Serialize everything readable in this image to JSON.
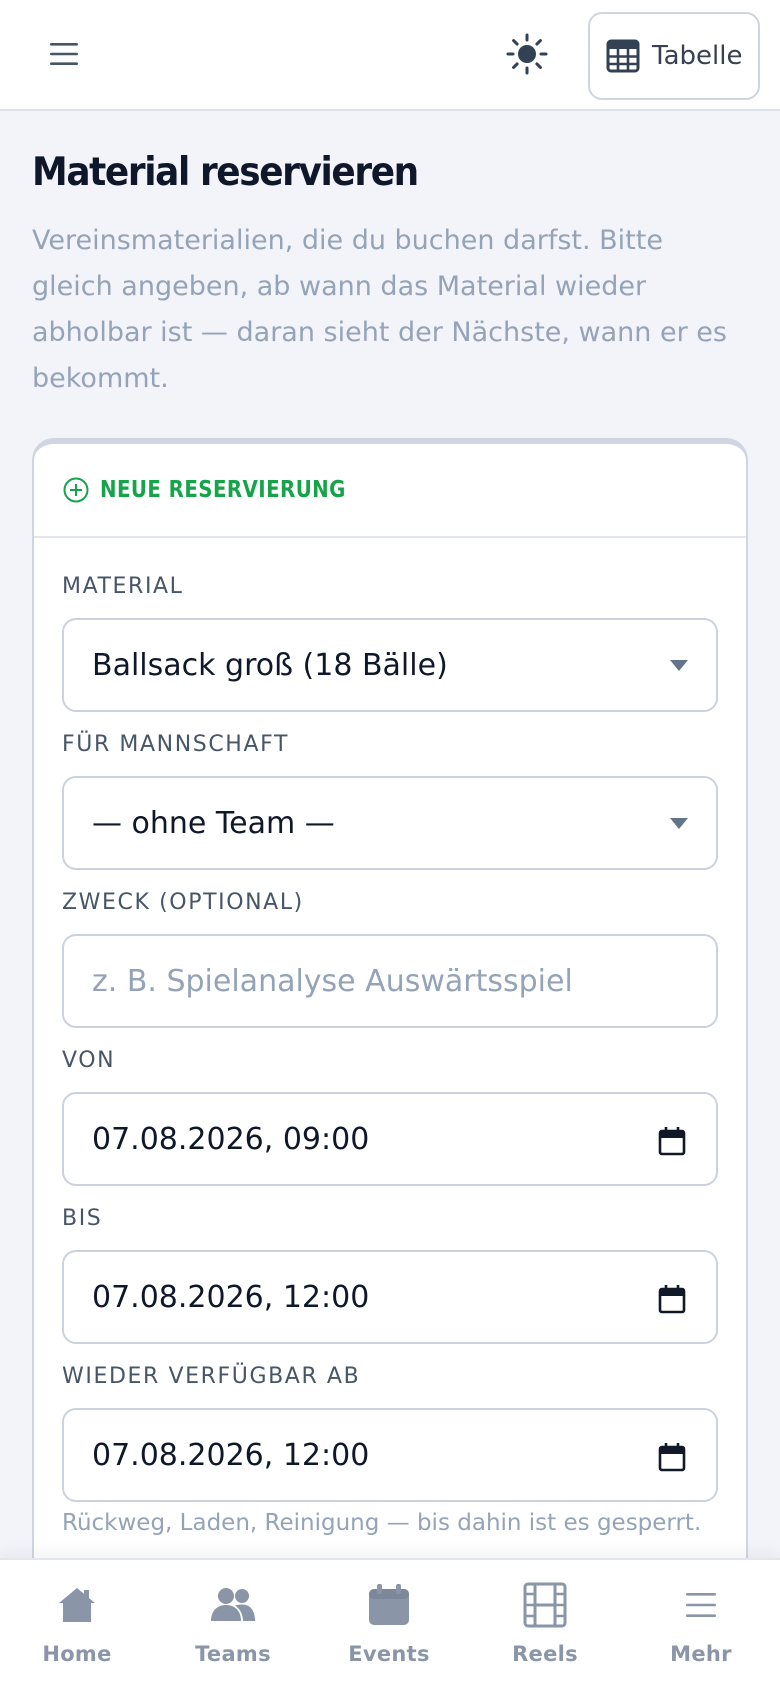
{
  "topbar": {
    "menu_icon": "hamburger-menu-icon",
    "theme_icon": "sun-icon",
    "table_button_label": "Tabelle",
    "table_icon": "table-grid-icon"
  },
  "page": {
    "title": "Material reservieren",
    "description": "Vereinsmaterialien, die du buchen darfst. Bitte gleich angeben, ab wann das Material wieder abholbar ist — daran sieht der Nächste, wann er es bekommt."
  },
  "form": {
    "header_icon": "plus-circle-icon",
    "header_title": "NEUE RESERVIERUNG",
    "material_label": "MATERIAL",
    "material_value": "Ballsack groß (18 Bälle)",
    "team_label": "FÜR MANNSCHAFT",
    "team_value": "— ohne Team —",
    "purpose_label": "ZWECK (OPTIONAL)",
    "purpose_placeholder": "z. B. Spielanalyse Auswärtsspiel",
    "from_label": "VON",
    "from_value": "07.08.2026, 09:00",
    "to_label": "BIS",
    "to_value": "07.08.2026, 12:00",
    "available_label": "WIEDER VERFÜGBAR AB",
    "available_value": "07.08.2026, 12:00",
    "available_hint": "Rückweg, Laden, Reinigung — bis dahin ist es gesperrt."
  },
  "bottom_nav": {
    "items": [
      {
        "label": "Home",
        "icon": "home-icon"
      },
      {
        "label": "Teams",
        "icon": "users-icon"
      },
      {
        "label": "Events",
        "icon": "calendar-icon"
      },
      {
        "label": "Reels",
        "icon": "film-icon"
      },
      {
        "label": "Mehr",
        "icon": "menu-icon"
      }
    ]
  },
  "colors": {
    "accent_green": "#16a34a",
    "muted_text": "#94a3b8",
    "nav_icon": "#8a95a8"
  }
}
